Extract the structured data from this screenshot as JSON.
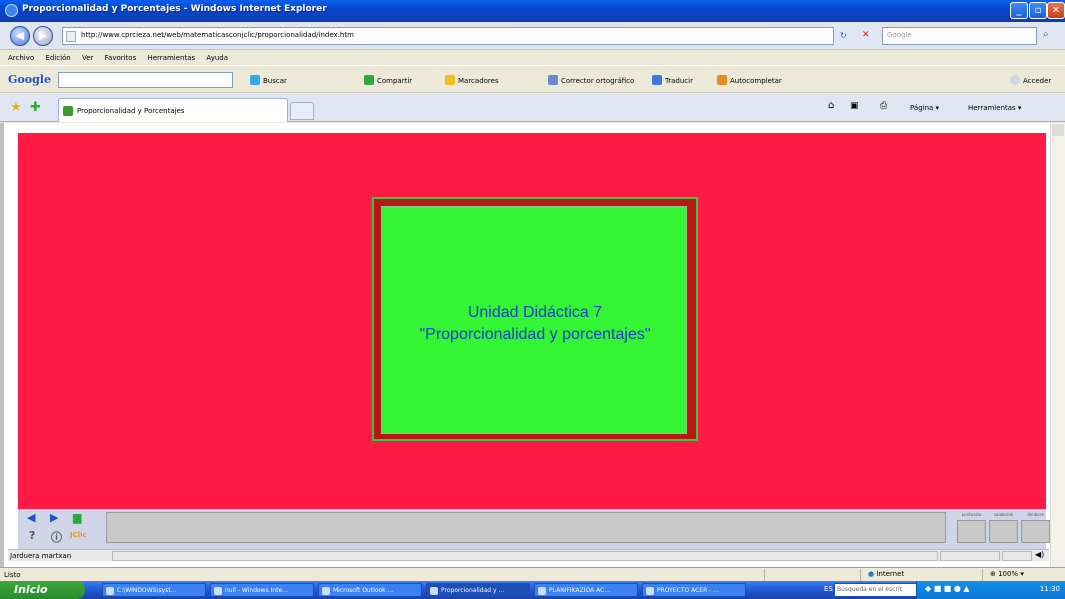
{
  "window": {
    "title": "Proporcionalidad y Porcentajes - Windows Internet Explorer"
  },
  "address_bar": {
    "url": "http://www.cprcieza.net/web/matematicasconjclic/proporcionalidad/index.htm",
    "search_placeholder": "Google"
  },
  "menu": {
    "items": [
      "Archivo",
      "Edición",
      "Ver",
      "Favoritos",
      "Herramientas",
      "Ayuda"
    ]
  },
  "google_toolbar": {
    "logo": "Google",
    "search_label": "Buscar",
    "share_label": "Compartir",
    "bookmarks_label": "Marcadores",
    "spellcheck_label": "Corrector ortográfico",
    "translate_label": "Traducir",
    "autofill_label": "Autocompletar",
    "signin_label": "Acceder"
  },
  "tabs": {
    "active_label": "Proporcionalidad y Porcentajes"
  },
  "command_bar": {
    "page_label": "Página",
    "tools_label": "Herramientas"
  },
  "activity": {
    "line1": "Unidad Didáctica 7",
    "line2": "\"Proporcionalidad y porcentajes\"",
    "logo": "JClic",
    "counters": [
      "puntuazio",
      "saiakerak",
      "denbora"
    ],
    "status_text": "Jarduera martxan"
  },
  "status_bar": {
    "text": "Listo",
    "zone": "Internet",
    "zoom": "100%"
  },
  "taskbar": {
    "start_label": "Inicio",
    "tasks": [
      "C:\\WINDOWS\\syst...",
      "null - Windows Inte...",
      "Microsoft Outlook ...",
      "Proporcionalidad y ...",
      "PLANIFIKAZIOA AC...",
      "PROYECTO ACER - ..."
    ],
    "language": "ES",
    "search_placeholder": "Búsqueda en el escrit",
    "clock": "11:30"
  }
}
